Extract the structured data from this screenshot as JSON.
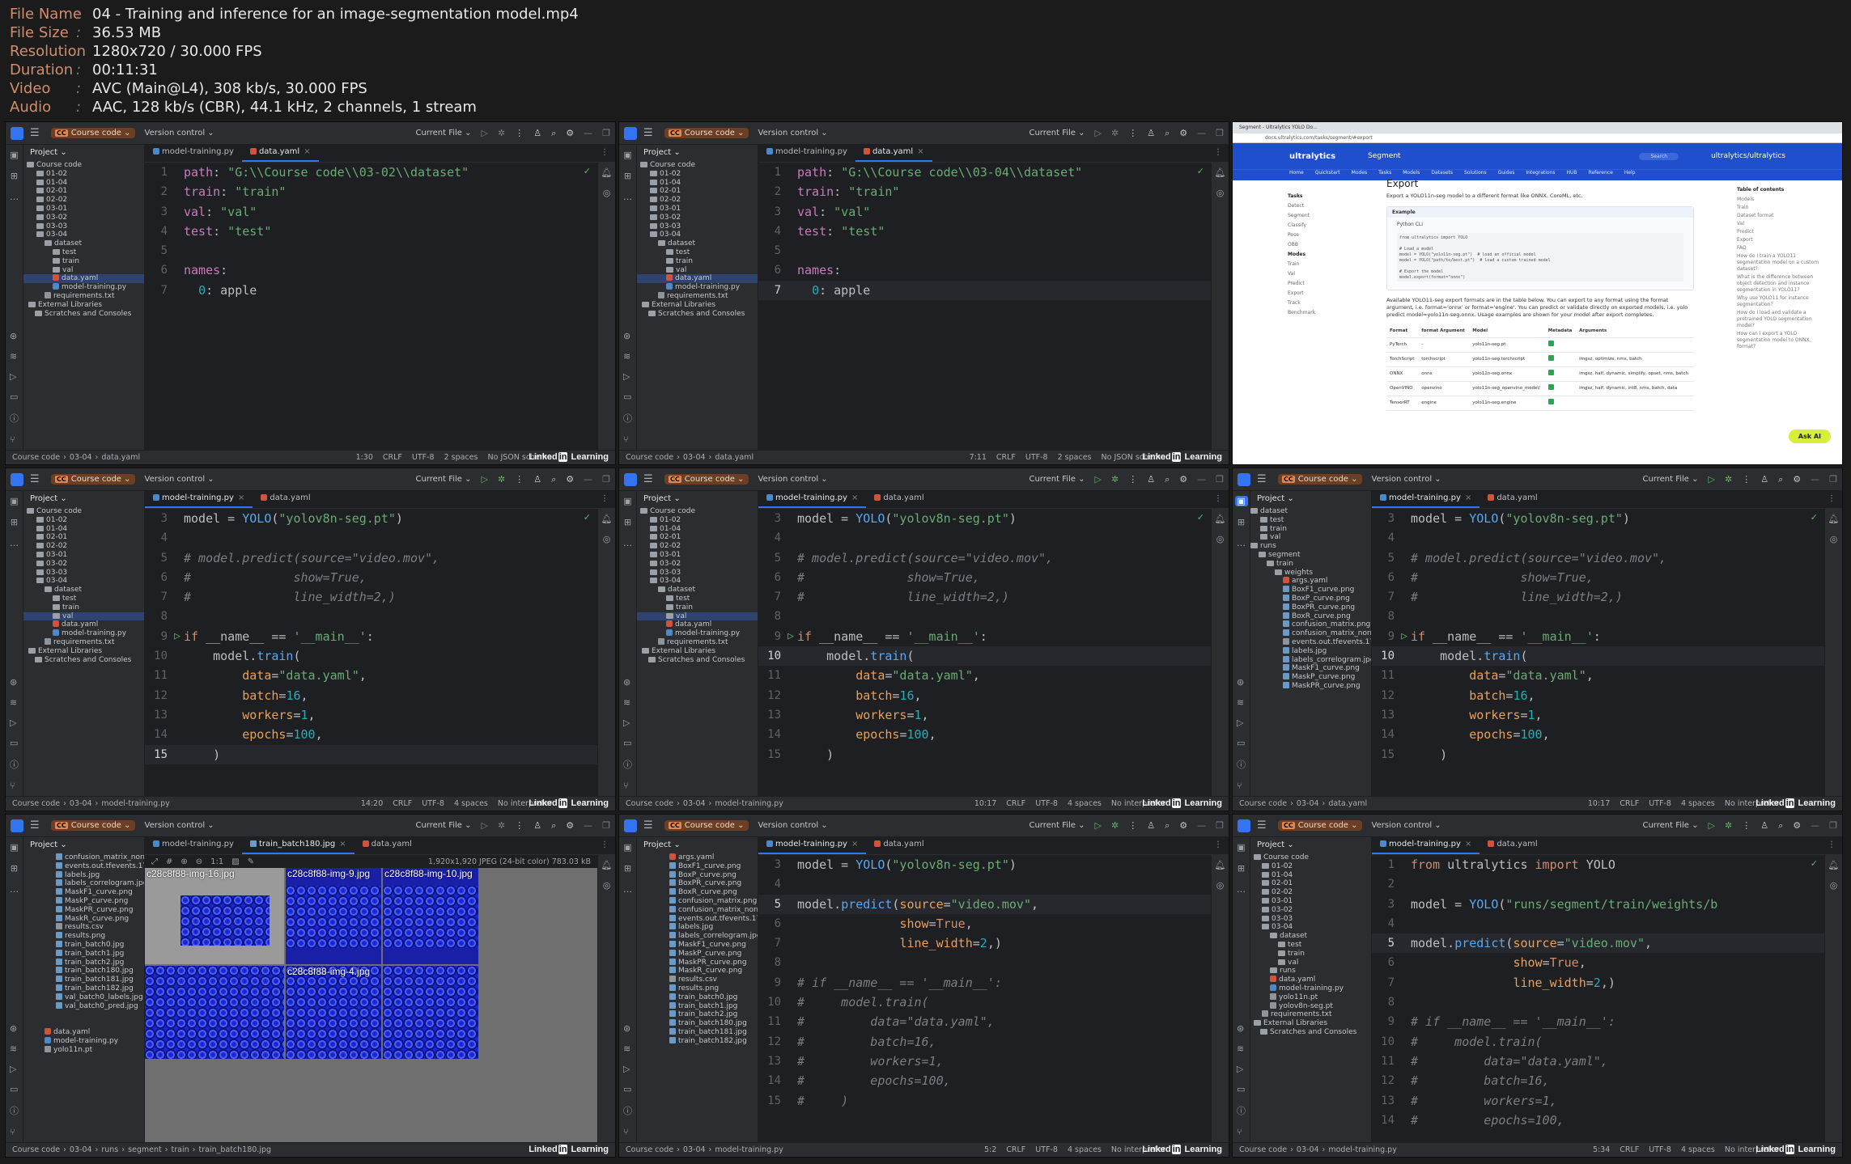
{
  "info": {
    "rows": [
      {
        "k": "File Name",
        "v": "04 - Training and inference for an image-segmentation model.mp4"
      },
      {
        "k": "File Size",
        "v": "36.53 MB"
      },
      {
        "k": "Resolution",
        "v": "1280x720 / 30.000 FPS"
      },
      {
        "k": "Duration",
        "v": "00:11:31"
      },
      {
        "k": "Video",
        "v": "AVC (Main@L4), 308 kb/s, 30.000 FPS"
      },
      {
        "k": "Audio",
        "v": "AAC, 128 kb/s (CBR), 44.1 kHz, 2 channels, 1 stream"
      }
    ]
  },
  "ide": {
    "project_name": "Course code",
    "version_control": "Version control",
    "current_file": "Current File",
    "project_label": "Project",
    "root": "Course code",
    "root_path": "G:\\Course code",
    "watermark": "Linked Learning",
    "external_libraries": "External Libraries",
    "scratches": "Scratches and Consoles"
  },
  "tiles": [
    {
      "tabs": [
        "model-training.py",
        "data.yaml"
      ],
      "active": 1,
      "tree": [
        "01-02",
        "01-04",
        "02-01",
        "02-02",
        "03-01",
        "03-02",
        "03-03",
        "03-04",
        "dataset",
        "test",
        "train",
        "val",
        "data.yaml",
        "model-training.py",
        "requirements.txt"
      ],
      "code_path": "G:\\\\Course code\\\\03-02\\\\dataset",
      "status": {
        "crumbs": [
          "Course code",
          "03-04",
          "data.yaml"
        ],
        "pos": "1:30",
        "eol": "CRLF",
        "enc": "UTF-8",
        "indent": "2 spaces",
        "schema": "No JSON schema"
      }
    },
    {
      "tabs": [
        "model-training.py",
        "data.yaml"
      ],
      "active": 1,
      "code_path": "G:\\\\Course code\\\\03-04\\\\dataset",
      "status": {
        "crumbs": [
          "Course code",
          "03-04",
          "data.yaml"
        ],
        "pos": "7:11",
        "eol": "CRLF",
        "enc": "UTF-8",
        "indent": "2 spaces",
        "schema": "No JSON schema"
      }
    },
    {
      "browser": {
        "tab_title": "Segment - Ultralytics YOLO Do...",
        "address": "docs.ultralytics.com/tasks/segment/#export",
        "brand": "ultralytics",
        "section": "Segment",
        "search": "Search",
        "repo": "ultralytics/ultralytics",
        "nav": [
          "Home",
          "Quickstart",
          "Modes",
          "Tasks",
          "Models",
          "Datasets",
          "Solutions",
          "Guides",
          "Integrations",
          "HUB",
          "Reference",
          "Help"
        ],
        "left_head": "Tasks",
        "left": [
          "Detect",
          "Segment",
          "Classify",
          "Pose",
          "OBB"
        ],
        "left_head2": "Modes",
        "left2": [
          "Train",
          "Val",
          "Predict",
          "Export",
          "Track",
          "Benchmark"
        ],
        "h2": "Export",
        "intro": "Export a YOLO11n-seg model to a different format like ONNX, CoreML, etc.",
        "example": "Example",
        "ex_tabs": "Python    CLI",
        "ex_code": "from ultralytics import YOLO\n\n# Load a model\nmodel = YOLO(\"yolo11n-seg.pt\")  # load an official model\nmodel = YOLO(\"path/to/best.pt\")  # load a custom trained model\n\n# Export the model\nmodel.export(format=\"onnx\")",
        "para": "Available YOLO11-seg export formats are in the table below. You can export to any format using the format argument, i.e. format='onnx' or format='engine'. You can predict or validate directly on exported models, i.e. yolo predict model=yolo11n-seg.onnx. Usage examples are shown for your model after export completes.",
        "cols": [
          "Format",
          "format Argument",
          "Model",
          "Metadata",
          "Arguments"
        ],
        "rows": [
          [
            "PyTorch",
            "-",
            "yolo11n-seg.pt",
            ""
          ],
          [
            "TorchScript",
            "torchscript",
            "yolo11n-seg.torchscript",
            "imgsz, optimize, nms, batch"
          ],
          [
            "ONNX",
            "onnx",
            "yolo11n-seg.onnx",
            "imgsz, half, dynamic, simplify, opset, nms, batch"
          ],
          [
            "OpenVINO",
            "openvino",
            "yolo11n-seg_openvino_model/",
            "imgsz, half, dynamic, int8, nms, batch, data"
          ],
          [
            "TensorRT",
            "engine",
            "yolo11n-seg.engine",
            ""
          ]
        ],
        "toc_head": "Table of contents",
        "toc": [
          "Models",
          "Train",
          "Dataset format",
          "Val",
          "Predict",
          "Export",
          "FAQ",
          "How do I train a YOLO11 segmentation model on a custom dataset?",
          "What is the difference between object detection and instance segmentation in YOLO11?",
          "Why use YOLO11 for instance segmentation?",
          "How do I load and validate a pretrained YOLO segmentation model?",
          "How can I export a YOLO segmentation model to ONNX format?"
        ],
        "ask": "Ask AI"
      }
    },
    {
      "tabs": [
        "model-training.py",
        "data.yaml"
      ],
      "active": 0,
      "status": {
        "crumbs": [
          "Course code",
          "03-04",
          "model-training.py"
        ],
        "pos": "14:20",
        "eol": "CRLF",
        "enc": "UTF-8",
        "indent": "4 spaces",
        "schema": "No interpreter"
      }
    },
    {
      "tabs": [
        "model-training.py",
        "data.yaml"
      ],
      "active": 0,
      "status": {
        "crumbs": [
          "Course code",
          "03-04",
          "model-training.py"
        ],
        "pos": "10:17",
        "eol": "CRLF",
        "enc": "UTF-8",
        "indent": "4 spaces",
        "schema": "No interpreter"
      }
    },
    {
      "tabs": [
        "model-training.py",
        "data.yaml"
      ],
      "active": 0,
      "tree": [
        "dataset",
        "test",
        "train",
        "val",
        "runs",
        "segment",
        "train",
        "weights",
        "args.yaml",
        "BoxF1_curve.png",
        "BoxP_curve.png",
        "BoxPR_curve.png",
        "BoxR_curve.png",
        "confusion_matrix.png",
        "confusion_matrix_norma",
        "events.out.tfevents.1742",
        "labels.jpg",
        "labels_correlogram.jpg",
        "MaskF1_curve.png",
        "MaskP_curve.png",
        "MaskPR_curve.png"
      ],
      "status": {
        "crumbs": [
          "Course code",
          "03-04",
          "data.yaml"
        ],
        "pos": "10:17",
        "eol": "CRLF",
        "enc": "UTF-8",
        "indent": "4 spaces",
        "schema": "No interpreter"
      }
    },
    {
      "tabs": [
        "model-training.py",
        "train_batch180.jpg",
        "data.yaml"
      ],
      "active": 1,
      "tree": [
        "confusion_matrix_norma",
        "events.out.tfevents.1742",
        "labels.jpg",
        "labels_correlogram.jpg",
        "MaskF1_curve.png",
        "MaskP_curve.png",
        "MaskPR_curve.png",
        "MaskR_curve.png",
        "results.csv",
        "results.png",
        "train_batch0.jpg",
        "train_batch1.jpg",
        "train_batch2.jpg",
        "train_batch180.jpg",
        "train_batch181.jpg",
        "train_batch182.jpg",
        "val_batch0_labels.jpg",
        "val_batch0_pred.jpg",
        "",
        "",
        "data.yaml",
        "model-training.py",
        "yolo11n.pt"
      ],
      "viewer_meta": "1,920x1,920 JPEG (24-bit color) 783.03 kB",
      "zoom": "1:1",
      "cells": [
        "c28c8f88-img-16.jpg",
        "c28c8f88-img-9.jpg",
        "c28c8f88-img-10.jpg",
        "",
        "c28c8f88-img-4.jpg",
        ""
      ],
      "status": {
        "crumbs": [
          "Course code",
          "03-04",
          "runs",
          "segment",
          "train",
          "train_batch180.jpg"
        ]
      }
    },
    {
      "tabs": [
        "model-training.py",
        "data.yaml"
      ],
      "active": 0,
      "tree": [
        "args.yaml",
        "BoxF1_curve.png",
        "BoxP_curve.png",
        "BoxPR_curve.png",
        "BoxR_curve.png",
        "confusion_matrix.png",
        "confusion_matrix_norma",
        "events.out.tfevents.1742",
        "labels.jpg",
        "labels_correlogram.jpg",
        "MaskF1_curve.png",
        "MaskP_curve.png",
        "MaskPR_curve.png",
        "MaskR_curve.png",
        "results.csv",
        "results.png",
        "train_batch0.jpg",
        "train_batch1.jpg",
        "train_batch2.jpg",
        "train_batch180.jpg",
        "train_batch181.jpg",
        "train_batch182.jpg"
      ],
      "status": {
        "crumbs": [
          "Course code",
          "03-04",
          "model-training.py"
        ],
        "pos": "5:2",
        "eol": "CRLF",
        "enc": "UTF-8",
        "indent": "4 spaces",
        "schema": "No interpreter"
      }
    },
    {
      "tabs": [
        "model-training.py",
        "data.yaml"
      ],
      "active": 0,
      "tree": [
        "Course code",
        "01-02",
        "01-04",
        "02-01",
        "02-02",
        "03-01",
        "03-02",
        "03-03",
        "03-04",
        "dataset",
        "test",
        "train",
        "val",
        "runs",
        "data.yaml",
        "model-training.py",
        "yolo11n.pt",
        "yolov8n-seg.pt",
        "requirements.txt",
        "External Libraries",
        "Scratches and Consoles"
      ],
      "status": {
        "crumbs": [
          "Course code",
          "03-04",
          "model-training.py"
        ],
        "pos": "5:34",
        "eol": "CRLF",
        "enc": "UTF-8",
        "indent": "4 spaces",
        "schema": "No interpreter"
      }
    }
  ]
}
